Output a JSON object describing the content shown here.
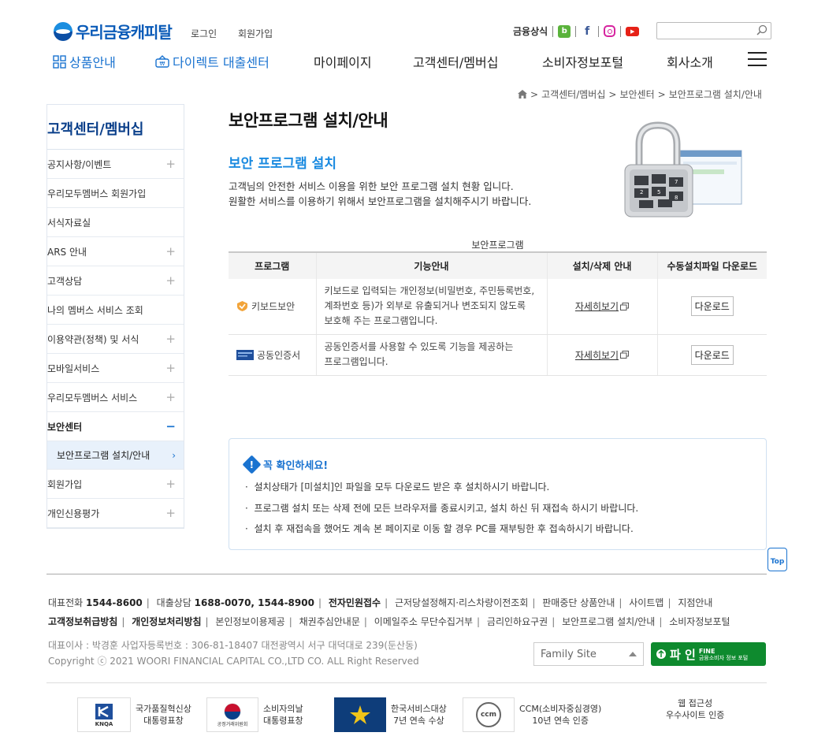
{
  "header": {
    "logo_text": "우리금융캐피탈",
    "login": "로그인",
    "join": "회원가입",
    "finance_common": "금융상식",
    "search_placeholder": ""
  },
  "gnb": {
    "product": "상품안내",
    "direct": "다이렉트 대출센터",
    "mypage": "마이페이지",
    "customer": "고객센터/멤버십",
    "consumer": "소비자정보포털",
    "company": "회사소개"
  },
  "breadcrumb": {
    "items": [
      "고객센터/멤버십",
      "보안센터",
      "보안프로그램 설치/안내"
    ]
  },
  "sidebar": {
    "title": "고객센터/멤버십",
    "items": [
      {
        "label": "공지사항/이벤트",
        "toggle": "+"
      },
      {
        "label": "우리모두멤버스 회원가입",
        "toggle": ""
      },
      {
        "label": "서식자료실",
        "toggle": ""
      },
      {
        "label": "ARS 안내",
        "toggle": "+"
      },
      {
        "label": "고객상담",
        "toggle": "+"
      },
      {
        "label": "나의 멤버스 서비스 조회",
        "toggle": ""
      },
      {
        "label": "이용약관(정책) 및 서식",
        "toggle": "+"
      },
      {
        "label": "모바일서비스",
        "toggle": "+"
      },
      {
        "label": "우리모두멤버스 서비스",
        "toggle": "+"
      },
      {
        "label": "보안센터",
        "toggle": "−"
      }
    ],
    "sub_active": "보안프로그램 설치/안내",
    "items_after": [
      {
        "label": "회원가입",
        "toggle": "+"
      },
      {
        "label": "개인신용평가",
        "toggle": "+"
      }
    ]
  },
  "main": {
    "title": "보안프로그램 설치/안내",
    "subtitle": "보안 프로그램 설치",
    "desc1": "고객님의 안전한 서비스 이용을 위한 보안 프로그램 설치 현황 입니다.",
    "desc2": "원활한 서비스를 이용하기 위해서 보안프로그램을 설치해주시기 바랍니다.",
    "table_caption": "보안프로그램",
    "columns": [
      "프로그램",
      "기능안내",
      "설치/삭제 안내",
      "수동설치파일 다운로드"
    ],
    "rows": [
      {
        "program": "키보드보안",
        "func_lines": [
          "키보드로 입력되는 개인정보(비밀번호, 주민등록번호,",
          "계좌번호 등)가 외부로 유출되거나 변조되지 않도록",
          "보호해 주는 프로그램입니다."
        ],
        "detail": "자세히보기",
        "download": "다운로드"
      },
      {
        "program": "공동인증서",
        "func_lines": [
          "공동인증서를 사용할 수 있도록 기능을 제공하는",
          "프로그램입니다."
        ],
        "detail": "자세히보기",
        "download": "다운로드"
      }
    ]
  },
  "notice": {
    "title": "꼭 확인하세요!",
    "items": [
      "설치상태가 [미설치]인 파일을 모두 다운로드 받은 후 설치하시기 바랍니다.",
      "프로그램 설치 또는 삭제 전에 모든 브라우저를 종료시키고, 설치 하신 뒤 재접속 하시기 바랍니다.",
      "설치 후 재접속을 했어도 계속 본 페이지로 이동 할 경우 PC를 재부팅한 후 접속하시기 바랍니다."
    ]
  },
  "top_button": "Top",
  "footer": {
    "rep_label": "대표전화",
    "rep_phone": "1544-8600",
    "loan_label": "대출상담",
    "loan_phone": "1688-0070, 1544-8900",
    "e_complaint": "전자민원접수",
    "links1": [
      "근저당설정해지·리스차량이전조회",
      "판매중단 상품안내",
      "사이트맵",
      "지점안내"
    ],
    "bold_links": [
      "고객정보취급방침",
      "개인정보처리방침"
    ],
    "links2": [
      "본인정보이용제공",
      "채권추심안내문",
      "이메일주소 무단수집거부",
      "금리인하요구권",
      "보안프로그램 설치/안내",
      "소비자정보포털"
    ],
    "ceo": "대표이사 : 박경훈   사업자등록번호 : 306-81-18407   대전광역시 서구 대덕대로 239(둔산동)",
    "copyright": "Copyright ⓒ 2021 WOORI FINANCIAL CAPITAL CO.,LTD CO. ALL Right Reserved",
    "family_site": "Family Site",
    "fine_big": "파 인",
    "fine_top": "FINE",
    "fine_small": "금융소비자 정보 포털",
    "awards": [
      {
        "logo": "KNQA",
        "line1": "국가품질혁신상",
        "line2": "대통령표창"
      },
      {
        "logo": "공정거래위원회",
        "line1": "소비자의날",
        "line2": "대통령표창"
      },
      {
        "logo": "",
        "line1": "한국서비스대상",
        "line2": "7년 연속 수상"
      },
      {
        "logo": "ccm",
        "line1": "CCM(소비자중심경영)",
        "line2": "10년 연속 인증"
      },
      {
        "logo": "",
        "line1": "웹 접근성",
        "line2": "우수사이트 인증"
      }
    ]
  }
}
